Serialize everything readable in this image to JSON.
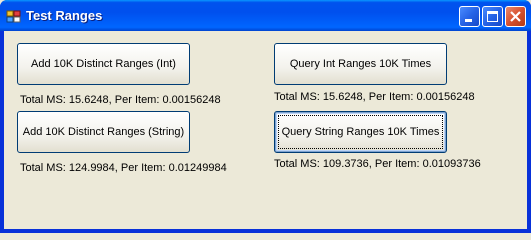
{
  "window": {
    "title": "Test Ranges"
  },
  "buttons": {
    "add_int": "Add 10K Distinct Ranges (Int)",
    "query_int": "Query Int Ranges 10K Times",
    "add_string": "Add 10K Distinct Ranges (String)",
    "query_string": "Query String Ranges 10K Times"
  },
  "results": {
    "add_int": "Total MS: 15.6248, Per Item: 0.00156248",
    "query_int": "Total MS: 15.6248, Per Item: 0.00156248",
    "add_string": "Total MS: 124.9984, Per Item: 0.01249984",
    "query_string": "Total MS: 109.3736, Per Item: 0.01093736"
  },
  "icons": {
    "app": "app-icon",
    "minimize": "minimize-icon",
    "maximize": "maximize-icon",
    "close": "close-icon"
  },
  "colors": {
    "titlebar": "#0054e3",
    "client_background": "#ece9d8",
    "close_button": "#d8512e"
  }
}
